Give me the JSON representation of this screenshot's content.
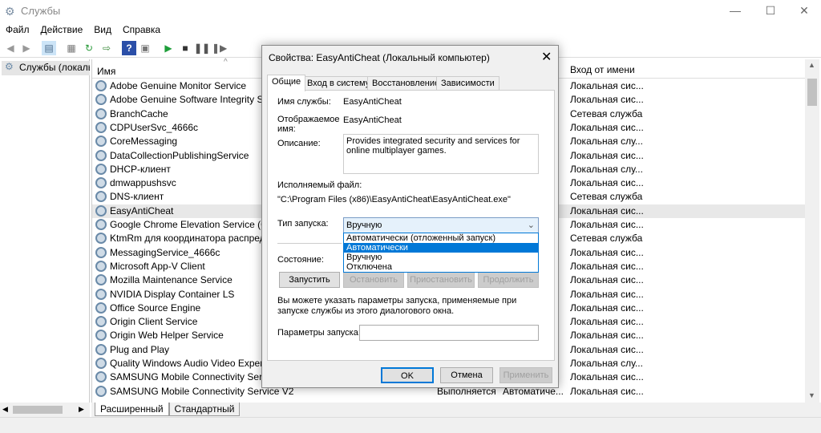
{
  "window": {
    "title": "Службы",
    "minimize": "—",
    "maximize": "☐",
    "close": "✕"
  },
  "menu": [
    "Файл",
    "Действие",
    "Вид",
    "Справка"
  ],
  "left": {
    "item": "Службы (локалы"
  },
  "columns": {
    "name": "Имя",
    "logon": "Вход от имени"
  },
  "rows": [
    {
      "name": "Adobe Genuine Monitor Service",
      "status": "",
      "type": "",
      "logon": "Локальная сис..."
    },
    {
      "name": "Adobe Genuine Software Integrity Servi",
      "status": "",
      "type": "",
      "logon": "Локальная сис..."
    },
    {
      "name": "BranchCache",
      "status": "",
      "type": "",
      "logon": "Сетевая служба"
    },
    {
      "name": "CDPUserSvc_4666c",
      "status": "",
      "type": "",
      "logon": "Локальная сис..."
    },
    {
      "name": "CoreMessaging",
      "status": "",
      "type": "",
      "logon": "Локальная слу..."
    },
    {
      "name": "DataCollectionPublishingService",
      "status": "",
      "type": "",
      "logon": "Локальная сис..."
    },
    {
      "name": "DHCP-клиент",
      "status": "",
      "type": "",
      "logon": "Локальная слу..."
    },
    {
      "name": "dmwappushsvc",
      "status": "",
      "type": "",
      "logon": "Локальная сис..."
    },
    {
      "name": "DNS-клиент",
      "status": "",
      "type": "",
      "logon": "Сетевая служба"
    },
    {
      "name": "EasyAntiCheat",
      "status": "",
      "type": "",
      "logon": "Локальная сис..."
    },
    {
      "name": "Google Chrome Elevation Service (Goog",
      "status": "",
      "type": "",
      "logon": "Локальная сис..."
    },
    {
      "name": "KtmRm для координатора распределе",
      "status": "",
      "type": "",
      "logon": "Сетевая служба"
    },
    {
      "name": "MessagingService_4666c",
      "status": "",
      "type": "",
      "logon": "Локальная сис..."
    },
    {
      "name": "Microsoft App-V Client",
      "status": "",
      "type": "",
      "logon": "Локальная сис..."
    },
    {
      "name": "Mozilla Maintenance Service",
      "status": "",
      "type": "",
      "logon": "Локальная сис..."
    },
    {
      "name": "NVIDIA Display Container LS",
      "status": "",
      "type": "",
      "logon": "Локальная сис..."
    },
    {
      "name": "Office  Source Engine",
      "status": "",
      "type": "",
      "logon": "Локальная сис..."
    },
    {
      "name": "Origin Client Service",
      "status": "",
      "type": "",
      "logon": "Локальная сис..."
    },
    {
      "name": "Origin Web Helper Service",
      "status": "",
      "type": "",
      "logon": "Локальная сис..."
    },
    {
      "name": "Plug and Play",
      "status": "",
      "type": "",
      "logon": "Локальная сис..."
    },
    {
      "name": "Quality Windows Audio Video Experienc",
      "status": "",
      "type": "",
      "logon": "Локальная слу..."
    },
    {
      "name": "SAMSUNG Mobile Connectivity Service",
      "status": "",
      "type": "",
      "logon": "Локальная сис..."
    },
    {
      "name": "SAMSUNG Mobile Connectivity Service V2",
      "status": "Выполняется",
      "type": "Автоматиче...",
      "logon": "Локальная сис..."
    }
  ],
  "bottom_tabs": [
    "Расширенный",
    "Стандартный"
  ],
  "dialog": {
    "title": "Свойства: EasyAntiCheat (Локальный компьютер)",
    "tabs": [
      "Общие",
      "Вход в систему",
      "Восстановление",
      "Зависимости"
    ],
    "service_name_label": "Имя службы:",
    "service_name": "EasyAntiCheat",
    "display_name_label": "Отображаемое имя:",
    "display_name": "EasyAntiCheat",
    "description_label": "Описание:",
    "description": "Provides integrated security and services for online multiplayer games.",
    "exe_label": "Исполняемый файл:",
    "exe_path": "\"C:\\Program Files (x86)\\EasyAntiCheat\\EasyAntiCheat.exe\"",
    "startup_label": "Тип запуска:",
    "startup_value": "Вручную",
    "startup_options": [
      "Автоматически (отложенный запуск)",
      "Автоматически",
      "Вручную",
      "Отключена"
    ],
    "state_label": "Состояние:",
    "start": "Запустить",
    "stop": "Остановить",
    "pause": "Приостановить",
    "resume": "Продолжить",
    "hint": "Вы можете указать параметры запуска, применяемые при запуске службы из этого диалогового окна.",
    "params_label": "Параметры запуска:",
    "params_value": "",
    "ok": "OK",
    "cancel": "Отмена",
    "apply": "Применить"
  }
}
